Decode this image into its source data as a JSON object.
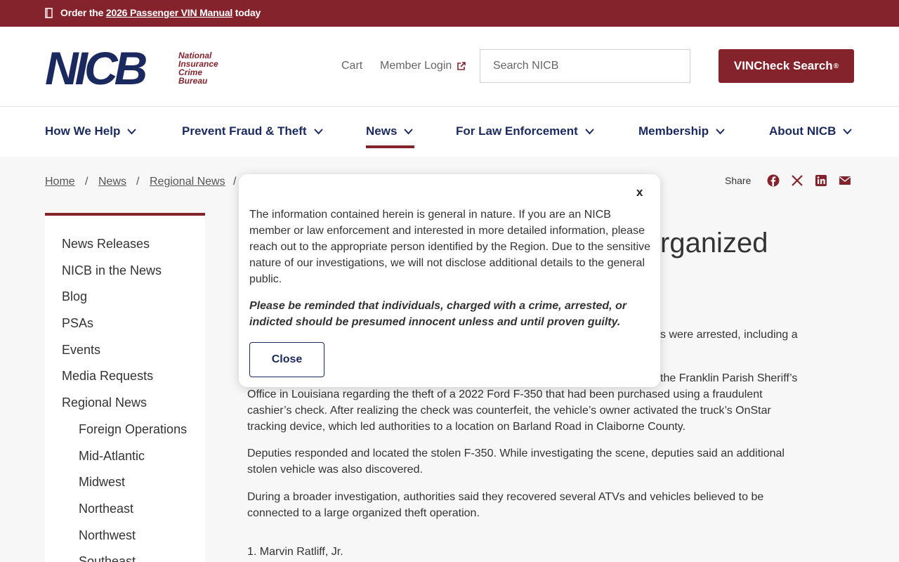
{
  "topbar": {
    "promo_prefix": "Order the ",
    "promo_link": "2026 Passenger VIN Manual",
    "promo_suffix": " today"
  },
  "logo": {
    "mark": "NICB",
    "line1": "National",
    "line2": "Insurance",
    "line3": "Crime",
    "line4": "Bureau"
  },
  "header": {
    "cart": "Cart",
    "member_login": "Member Login",
    "search_placeholder": "Search NICB",
    "vin_button": "VINCheck Search",
    "vin_button_mark": "®"
  },
  "nav": {
    "items": [
      "How We Help",
      "Prevent Fraud & Theft",
      "News",
      "For Law Enforcement",
      "Membership",
      "About NICB"
    ],
    "active": "News"
  },
  "breadcrumb": {
    "home": "Home",
    "news": "News",
    "regional": "Regional News",
    "sep": "/"
  },
  "share": {
    "label": "Share"
  },
  "sidebar": {
    "items": [
      "News Releases",
      "NICB in the News",
      "Blog",
      "PSAs",
      "Events",
      "Media Requests",
      "Regional News"
    ],
    "subitems": [
      "Foreign Operations",
      "Mid-Atlantic",
      "Midwest",
      "Northeast",
      "Northwest",
      "Southeast"
    ]
  },
  "article": {
    "title_fragment": "rganized",
    "frag_arrested": "s were arrested, including a",
    "frag_sheriff": "the Franklin Parish Sheriff’s",
    "para1_rest": "Office in Louisiana regarding the theft of a 2022 Ford F-350 that had been purchased using a fraudulent cashier’s check. After realizing the check was counterfeit, the vehicle’s owner activated the truck’s OnStar tracking device, which led authorities to a location on Barland Road in Claiborne County.",
    "para2": "Deputies responded and located the stolen F-350. While investigating the scene, deputies said an additional stolen vehicle was also discovered.",
    "para3": "During a broader investigation, authorities said they recovered several ATVs and vehicles believed to be connected to a large organized theft operation.",
    "list_item_1": "1. Marvin Ratliff, Jr."
  },
  "modal": {
    "close_x": "x",
    "body": "The information contained herein is general in nature. If you are an NICB member or law enforcement and interested in more detailed information, please reach out to the appropriate person identified by the Region. Due to the sensitive nature of our investigations, we will not disclose additional details to the general public.",
    "note": "Please be reminded that individuals, charged with a crime, arrested, or indicted should be presumed innocent unless and until proven guilty.",
    "close_button": "Close"
  },
  "colors": {
    "brand_red": "#84232c",
    "brand_navy": "#1b2a5e"
  }
}
